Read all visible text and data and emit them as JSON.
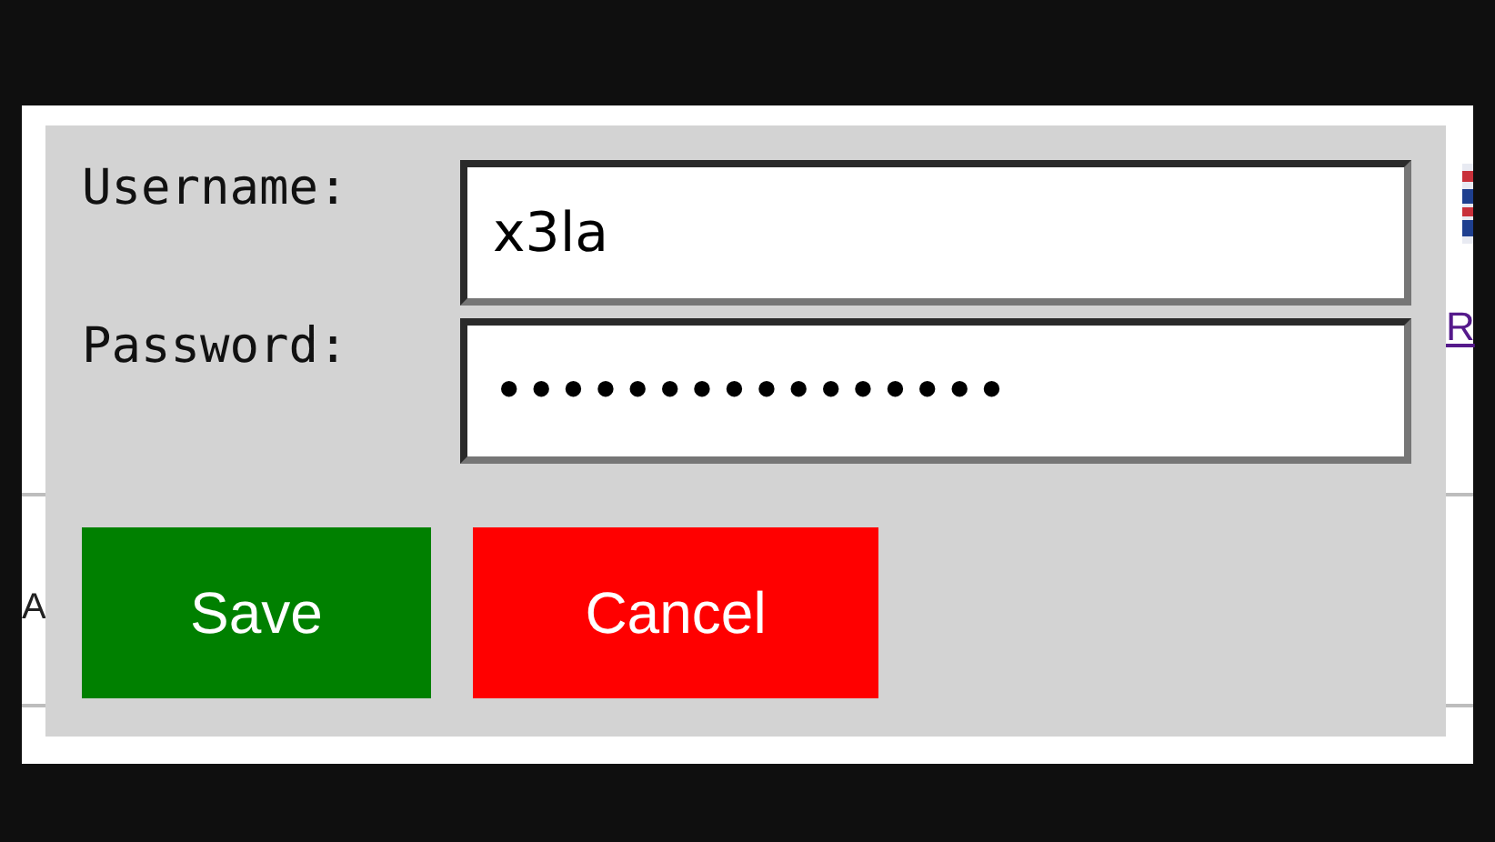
{
  "background_page": {
    "row_text": "A",
    "link": "R"
  },
  "form": {
    "fields": [
      {
        "label": "Username:",
        "value": "x3la"
      },
      {
        "label": "Password:",
        "value": "••••••••••••••••"
      }
    ],
    "buttons": [
      {
        "label": "Save",
        "kind": "save"
      },
      {
        "label": "Cancel",
        "kind": "cancel"
      }
    ]
  }
}
